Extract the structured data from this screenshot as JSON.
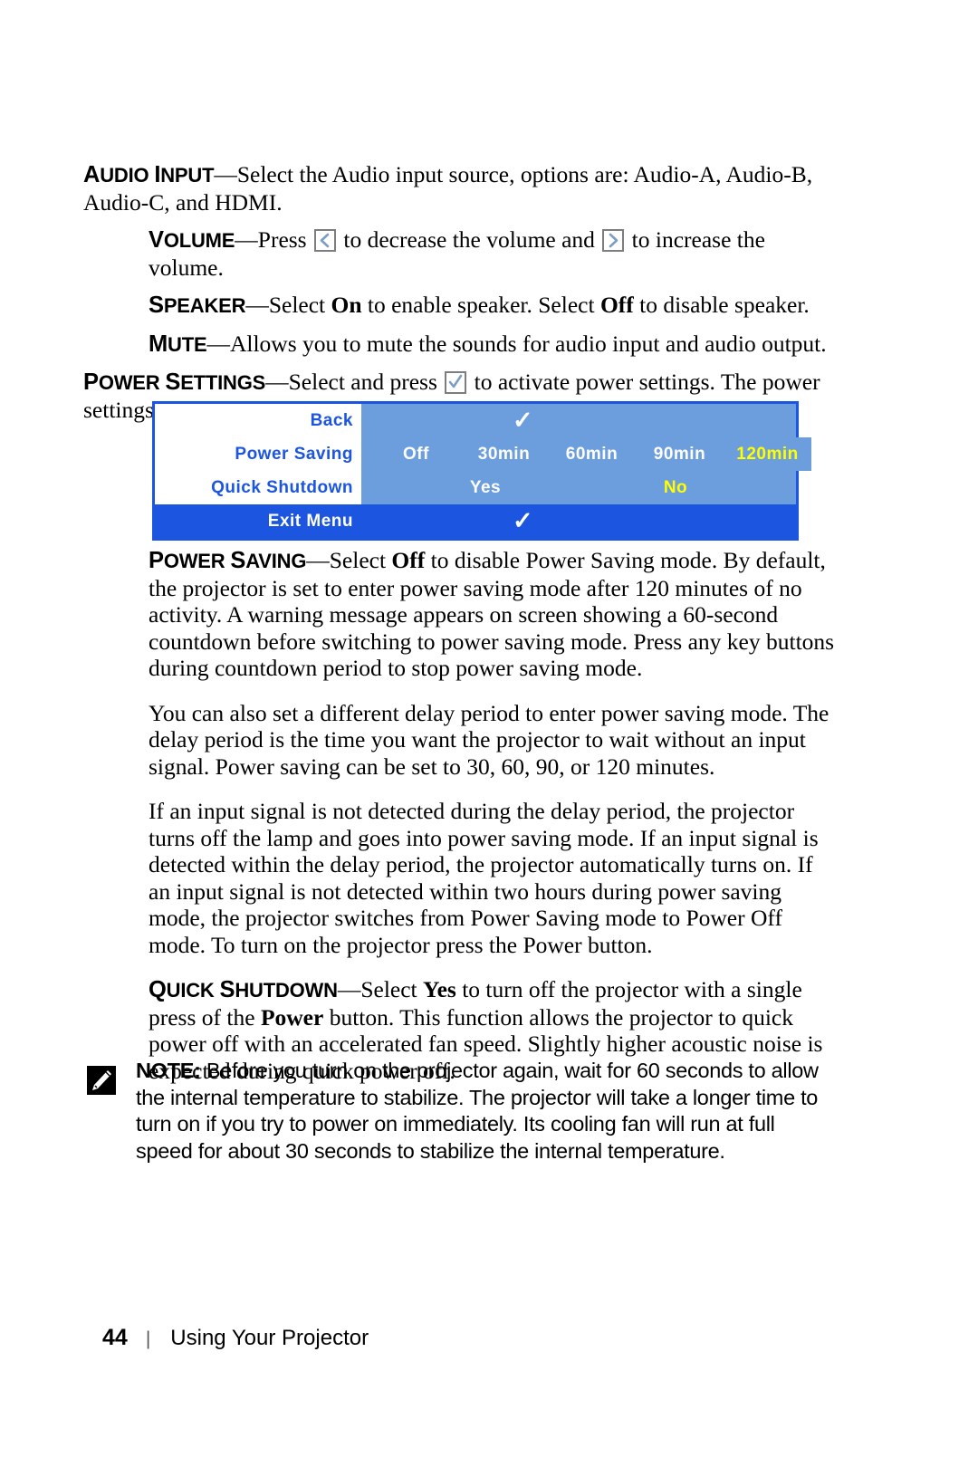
{
  "page": {
    "number": "44",
    "section": "Using Your Projector",
    "separator": "|"
  },
  "body": {
    "audio_input": {
      "head_cap": "A",
      "head_rest": "UDIO ",
      "head_cap2": "I",
      "head_rest2": "NPUT",
      "dash": "—",
      "text": "Select the Audio input source, options are: Audio-A, Audio-B, Audio-C, and HDMI."
    },
    "volume": {
      "head_cap": "V",
      "head_rest": "OLUME",
      "dash": "—",
      "text_1": "Press ",
      "text_2": " to decrease the volume and ",
      "text_3": " to increase the volume."
    },
    "speaker": {
      "head_cap": "S",
      "head_rest": "PEAKER",
      "dash": "—",
      "text_1": "Select ",
      "bold_1": "On",
      "text_2": " to enable speaker. Select ",
      "bold_2": "Off",
      "text_3": " to disable speaker."
    },
    "mute": {
      "head_cap": "M",
      "head_rest": "UTE",
      "dash": "—",
      "text": "Allows you to mute the sounds for audio input and audio output."
    },
    "power_settings": {
      "head_cap": "P",
      "head_rest": "OWER ",
      "head_cap2": "S",
      "head_rest2": "ETTINGS",
      "dash": "—",
      "text_1": "Select and press ",
      "text_2": " to activate power settings. The power settings menu consists of the following options:"
    },
    "power_saving": {
      "head_cap": "P",
      "head_rest": "OWER ",
      "head_cap2": "S",
      "head_rest2": "AVING",
      "dash": "—",
      "text_1": "Select ",
      "bold_1": "Off",
      "text_2": " to disable Power Saving mode. By default, the projector is set to enter power saving mode after 120 minutes of no activity. A warning message appears on screen showing a 60-second countdown before switching to power saving mode. Press any key buttons during countdown period to stop power saving mode."
    },
    "para_delay": "You can also set a different delay period to enter power saving mode. The delay period is the time you want the projector to wait without an input signal. Power saving can be set to 30, 60, 90, or 120 minutes.",
    "para_detect": "If an input signal is not detected during the delay period, the projector turns off the lamp and goes into power saving mode. If an input signal is detected within the delay period, the projector automatically turns on. If an input signal is not detected within two hours during power saving mode, the projector switches from Power Saving mode to Power Off mode. To turn on the projector press the Power button.",
    "quick_shutdown": {
      "head_cap": "Q",
      "head_rest": "UICK ",
      "head_cap2": "S",
      "head_rest2": "HUTDOWN",
      "dash": "—",
      "text_1": "Select ",
      "bold_1": "Yes",
      "text_2": " to turn off the projector with a single press of the ",
      "bold_2": "Power",
      "text_3": " button. This function allows the projector to quick power off with an accelerated fan speed. Slightly higher acoustic noise is expected during quick power off."
    }
  },
  "note": {
    "label": "NOTE:",
    "text": " Before you turn on the projector again, wait for 60 seconds to allow the internal temperature to stabilize. The projector will take a longer time to turn on if you try to power on immediately. Its cooling fan will run at full speed for about 30 seconds to stabilize the internal temperature."
  },
  "osd_menu": {
    "colors": {
      "border": "#1c55e0",
      "panel": "#6c9ede",
      "label_bg": "#ffffff",
      "label_text": "#1c55e0",
      "value_text": "#ffffff",
      "selected_text": "#ffff00",
      "exit_bg": "#1c55e0"
    },
    "rows": [
      {
        "label": "Back",
        "type": "check",
        "check": "✓"
      },
      {
        "label": "Power Saving",
        "type": "options",
        "options": [
          "Off",
          "30min",
          "60min",
          "90min",
          "120min"
        ],
        "selected": "120min"
      },
      {
        "label": "Quick Shutdown",
        "type": "options",
        "options": [
          "Yes",
          "No"
        ],
        "selected": "No"
      }
    ],
    "exit": {
      "label": "Exit Menu",
      "check": "✓"
    }
  },
  "icons": {
    "left_arrow": "left-arrow-key-icon",
    "right_arrow": "right-arrow-key-icon",
    "enter_check": "enter-check-key-icon",
    "note": "note-pencil-icon"
  }
}
